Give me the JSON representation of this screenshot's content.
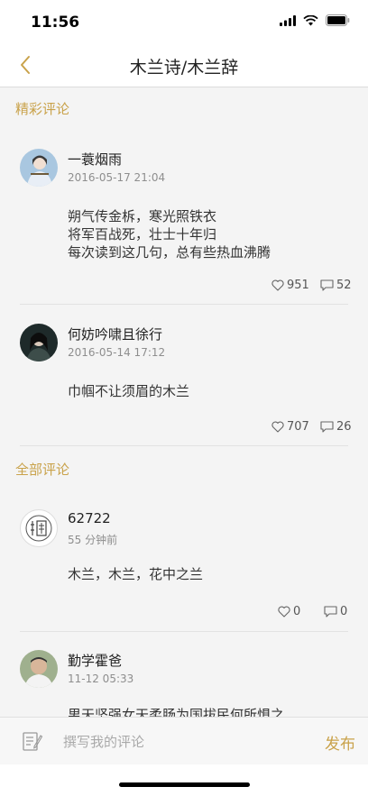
{
  "status": {
    "time": "11:56"
  },
  "nav": {
    "title": "木兰诗/木兰辞"
  },
  "sections": {
    "featured": "精彩评论",
    "all": "全部评论"
  },
  "featured": [
    {
      "user": "一蓑烟雨",
      "date": "2016-05-17 21:04",
      "text": "朔气传金柝，寒光照铁衣\n将军百战死，壮士十年归\n每次读到这几句，总有些热血沸腾",
      "likes": "951",
      "comments": "52"
    },
    {
      "user": "何妨吟啸且徐行",
      "date": "2016-05-14 17:12",
      "text": "巾帼不让须眉的木兰",
      "likes": "707",
      "comments": "26"
    }
  ],
  "all": [
    {
      "user": "62722",
      "date": "55 分钟前",
      "text": "木兰，木兰，花中之兰",
      "likes": "0",
      "comments": "0"
    },
    {
      "user": "勤学霍爸",
      "date": "11-12 05:33",
      "text": "男天坚强女天柔肠为国拔民何所惧之"
    }
  ],
  "bottom": {
    "placeholder": "撰写我的评论",
    "publish": "发布"
  },
  "colors": {
    "accent": "#c9a24a"
  }
}
